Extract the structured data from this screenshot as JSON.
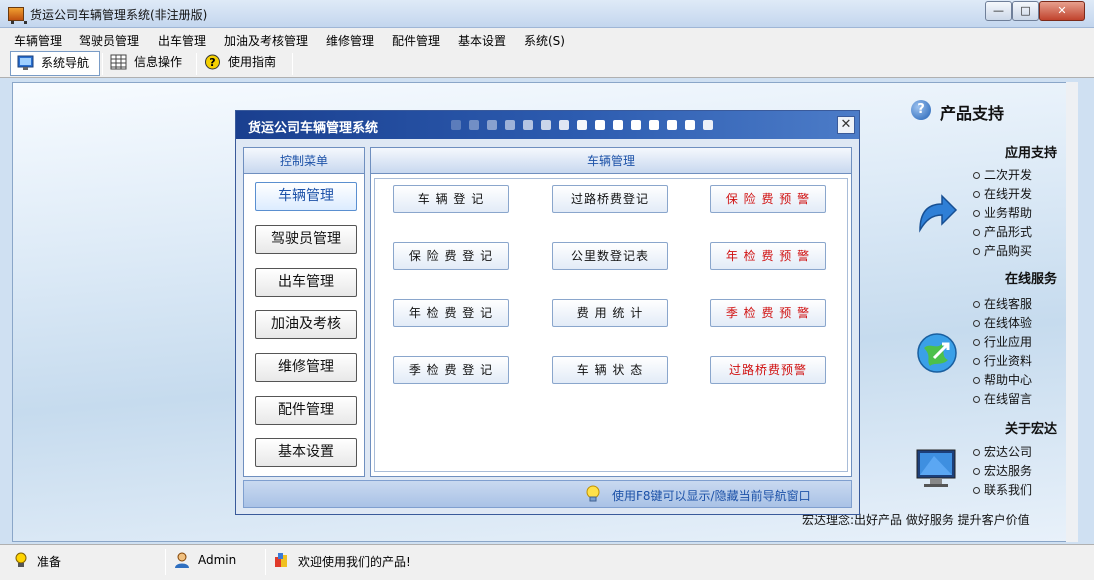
{
  "window": {
    "title": "货运公司车辆管理系统(非注册版)",
    "min": "—",
    "max": "□",
    "close": "✕"
  },
  "menu": [
    "车辆管理",
    "驾驶员管理",
    "出车管理",
    "加油及考核管理",
    "维修管理",
    "配件管理",
    "基本设置",
    "系统(S)"
  ],
  "toolbar": {
    "nav": "系统导航",
    "info": "信息操作",
    "guide": "使用指南"
  },
  "dialog": {
    "title": "货运公司车辆管理系统",
    "close": "✕",
    "control_menu_title": "控制菜单",
    "control_items": [
      "车辆管理",
      "驾驶员管理",
      "出车管理",
      "加油及考核",
      "维修管理",
      "配件管理",
      "基本设置"
    ],
    "main_title": "车辆管理",
    "actions": {
      "col1": [
        "车 辆 登 记",
        "保 险 费 登 记",
        "年 检 费 登 记",
        "季 检 费 登 记"
      ],
      "col2": [
        "过路桥费登记",
        "公里数登记表",
        "费 用 统 计",
        "车 辆 状 态"
      ],
      "col3": [
        "保 险 费 预 警",
        "年 检 费 预 警",
        "季 检 费 预 警",
        "过路桥费预警"
      ]
    },
    "hint": "使用F8键可以显示/隐藏当前导航窗口"
  },
  "support": {
    "title": "产品支持",
    "sections": [
      {
        "title": "应用支持",
        "items": [
          "二次开发",
          "在线开发",
          "业务帮助",
          "产品形式",
          "产品购买"
        ]
      },
      {
        "title": "在线服务",
        "items": [
          "在线客服",
          "在线体验",
          "行业应用",
          "行业资料",
          "帮助中心",
          "在线留言"
        ]
      },
      {
        "title": "关于宏达",
        "items": [
          "宏达公司",
          "宏达服务",
          "联系我们"
        ]
      }
    ],
    "slogan": "宏达理念:出好产品 做好服务 提升客户价值"
  },
  "status": {
    "ready": "准备",
    "user": "Admin",
    "welcome": "欢迎使用我们的产品!"
  },
  "colors": {
    "dialog_title": "#1a3f8f",
    "warning_text": "#d01010",
    "panel_header_text": "#1d52a8"
  }
}
